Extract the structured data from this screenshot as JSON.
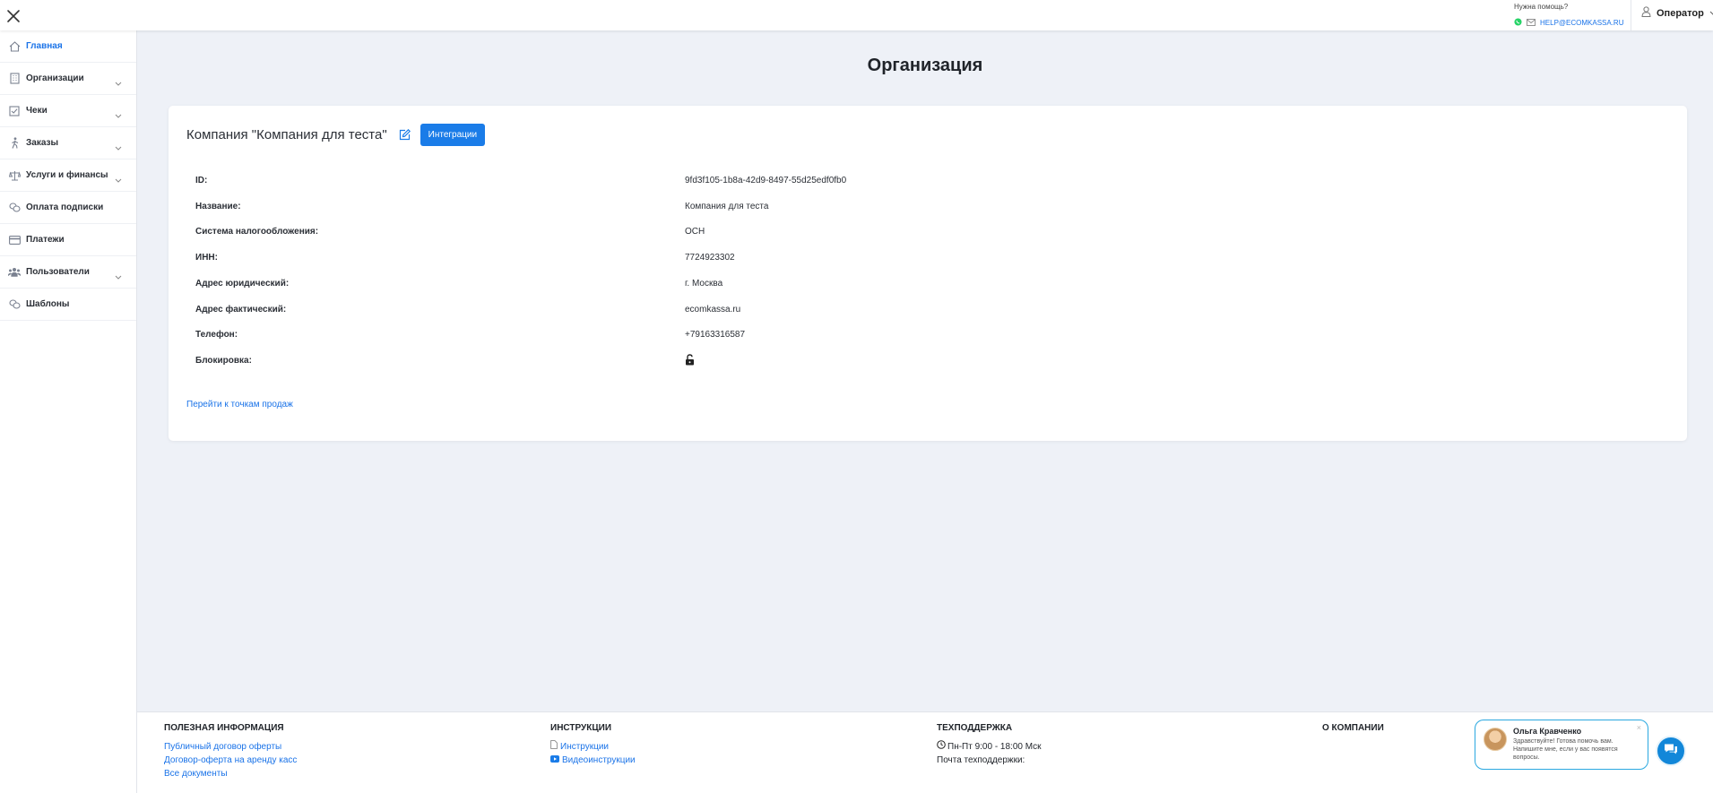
{
  "topbar": {
    "help_title": "Нужна помощь?",
    "help_email": "HELP@ECOMKASSA.RU",
    "user_label": "Оператор",
    "whatsapp_color": "#25d366"
  },
  "sidebar": {
    "items": [
      {
        "label": "Главная",
        "icon": "home-icon",
        "active": true,
        "expandable": false
      },
      {
        "label": "Организации",
        "icon": "building-icon",
        "active": false,
        "expandable": true
      },
      {
        "label": "Чеки",
        "icon": "check-square-icon",
        "active": false,
        "expandable": true
      },
      {
        "label": "Заказы",
        "icon": "walking-person-icon",
        "active": false,
        "expandable": true
      },
      {
        "label": "Услуги и финансы",
        "icon": "scales-icon",
        "active": false,
        "expandable": true
      },
      {
        "label": "Оплата подписки",
        "icon": "coins-icon",
        "active": false,
        "expandable": false
      },
      {
        "label": "Платежи",
        "icon": "credit-card-icon",
        "active": false,
        "expandable": false
      },
      {
        "label": "Пользователи",
        "icon": "users-icon",
        "active": false,
        "expandable": true
      },
      {
        "label": "Шаблоны",
        "icon": "coins-icon",
        "active": false,
        "expandable": false
      }
    ]
  },
  "main": {
    "title": "Организация",
    "company_title": "Компания \"Компания для теста\"",
    "integrations_label": "Интеграции",
    "fields": [
      {
        "label": "ID:",
        "value": "9fd3f105-1b8a-42d9-8497-55d25edf0fb0"
      },
      {
        "label": "Название:",
        "value": "Компания для теста"
      },
      {
        "label": "Система налогообложения:",
        "value": "ОСН"
      },
      {
        "label": "ИНН:",
        "value": "7724923302"
      },
      {
        "label": "Адрес юридический:",
        "value": "г. Москва"
      },
      {
        "label": "Адрес фактический:",
        "value": "ecomkassa.ru"
      },
      {
        "label": "Телефон:",
        "value": "+79163316587"
      },
      {
        "label": "Блокировка:",
        "value": "",
        "icon": "unlock-icon"
      }
    ],
    "sales_points_link": "Перейти к точкам продаж",
    "accent_color": "#1a7ce8"
  },
  "footer": {
    "useful": {
      "title": "ПОЛЕЗНАЯ ИНФОРМАЦИЯ",
      "links": [
        "Публичный договор оферты",
        "Договор-оферта на аренду касс",
        "Все документы"
      ]
    },
    "instructions": {
      "title": "ИНСТРУКЦИИ",
      "links": [
        "Инструкции",
        "Видеоинструкции"
      ]
    },
    "support": {
      "title": "ТЕХПОДДЕРЖКА",
      "hours": "Пн-Пт 9:00 - 18:00 Мск",
      "email_label": "Почта техподдержки:"
    },
    "about": {
      "title": "О КОМПАНИИ"
    }
  },
  "chat": {
    "name": "Ольга Кравченко",
    "message": "Здравствуйте! Готова помочь вам. Напишите мне, если у вас появятся вопросы.",
    "close": "×"
  }
}
